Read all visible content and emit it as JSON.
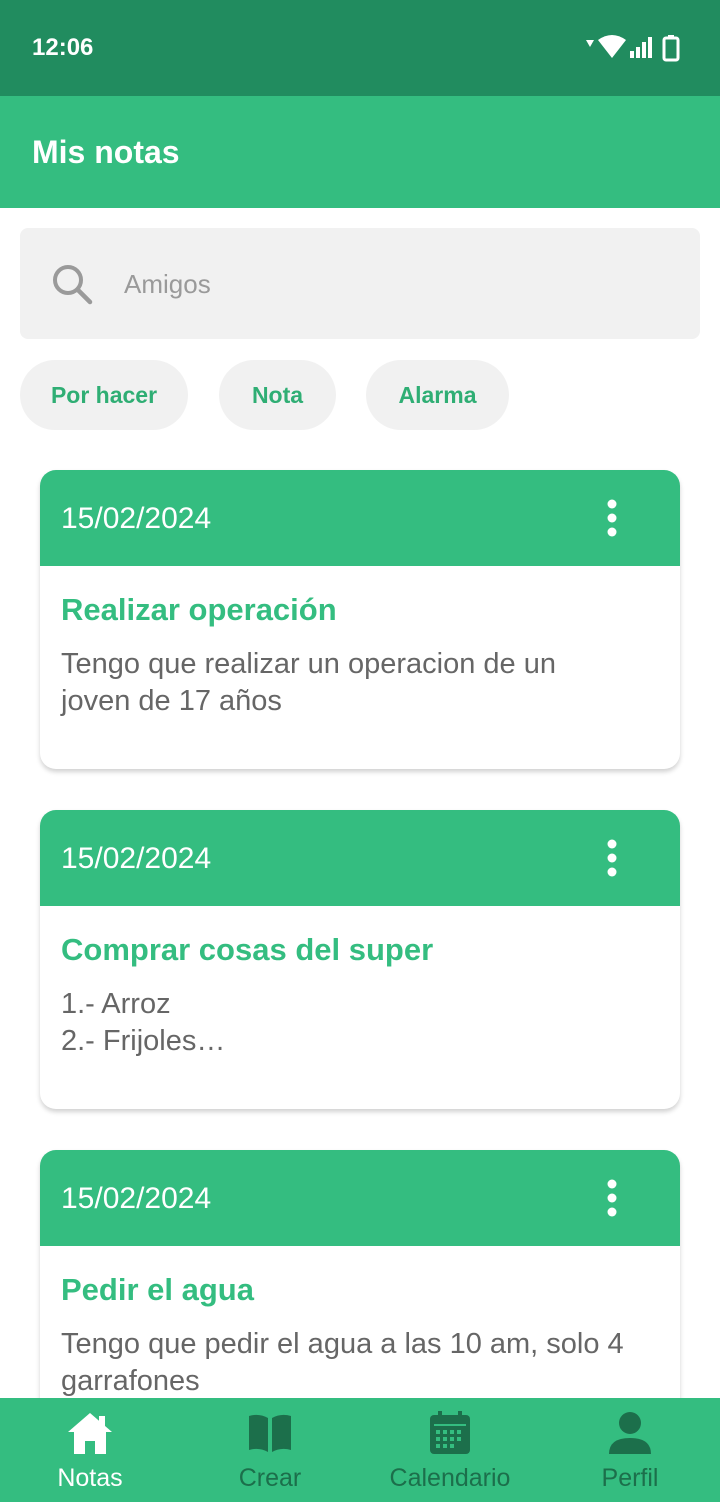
{
  "status_bar": {
    "time": "12:06"
  },
  "app_bar": {
    "title": "Mis notas"
  },
  "search": {
    "placeholder": "Amigos",
    "value": ""
  },
  "filters": [
    {
      "label": "Por hacer"
    },
    {
      "label": "Nota"
    },
    {
      "label": "Alarma"
    }
  ],
  "notes": [
    {
      "date": "15/02/2024",
      "title": "Realizar operación",
      "body": "Tengo que realizar un operacion de un\njoven de 17 años"
    },
    {
      "date": "15/02/2024",
      "title": "Comprar cosas del super",
      "body": "1.- Arroz\n2.- Frijoles…"
    },
    {
      "date": "15/02/2024",
      "title": "Pedir el agua",
      "body": "Tengo que pedir el agua a las 10 am, solo 4\ngarrafones"
    }
  ],
  "bottom_nav": [
    {
      "label": "Notas",
      "icon": "home-icon",
      "active": true
    },
    {
      "label": "Crear",
      "icon": "book-icon",
      "active": false
    },
    {
      "label": "Calendario",
      "icon": "calendar-icon",
      "active": false
    },
    {
      "label": "Perfil",
      "icon": "person-icon",
      "active": false
    }
  ],
  "colors": {
    "status_bar": "#218c5f",
    "primary": "#34bd80",
    "nav_inactive": "#1c6f4b",
    "chip_bg": "#f1f1f1"
  }
}
